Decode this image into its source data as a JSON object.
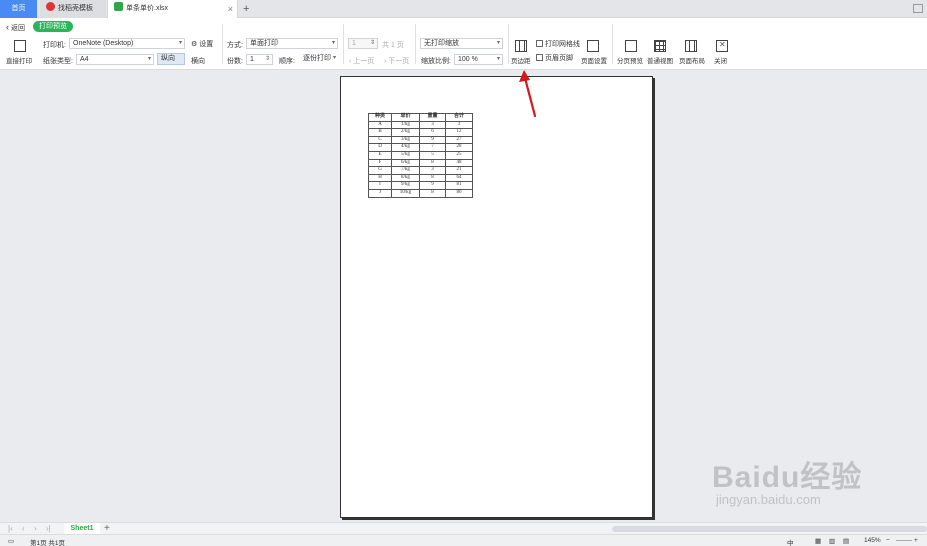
{
  "tabs": {
    "home": "首页",
    "second": "找稻壳模板",
    "active": "单条单价.xlsx",
    "close_glyph": "×",
    "add_glyph": "+"
  },
  "toolbar": {
    "back_label": "返回",
    "badge": "打印预览",
    "direct_print": "直接打印",
    "printer_label": "打印机:",
    "printer_value": "OneNote (Desktop)",
    "settings": "设置",
    "paper_label": "纸张类型:",
    "paper_value": "A4",
    "portrait": "纵向",
    "landscape": "横向",
    "mode_label": "方式:",
    "mode_value": "单面打印",
    "copies_label": "份数:",
    "copies_value": "1",
    "order_label": "顺序:",
    "order_value": "逐份打印",
    "page_input": "1",
    "page_total": "共 1 页",
    "prev_page": "上一页",
    "next_page": "下一页",
    "scale_value": "无打印缩放",
    "zoom_label": "缩放比例:",
    "zoom_value": "100 %",
    "margins": "页边距",
    "print_gridlines": "打印网格线",
    "header_footer": "页眉页脚",
    "page_setup": "页面设置",
    "page_break": "分页预览",
    "normal_view": "普通视图",
    "page_layout": "页面布局",
    "close": "关闭"
  },
  "table": {
    "headers": [
      "种类",
      "单价",
      "重量",
      "合计"
    ],
    "rows": [
      [
        "A",
        "1/kg",
        "3",
        "3"
      ],
      [
        "B",
        "2/kg",
        "6",
        "12"
      ],
      [
        "C",
        "3/kg",
        "9",
        "27"
      ],
      [
        "D",
        "4/kg",
        "7",
        "28"
      ],
      [
        "E",
        "5/kg",
        "5",
        "25"
      ],
      [
        "F",
        "6/kg",
        "8",
        "48"
      ],
      [
        "G",
        "7/kg",
        "3",
        "21"
      ],
      [
        "H",
        "8/kg",
        "8",
        "64"
      ],
      [
        "I",
        "9/kg",
        "9",
        "81"
      ],
      [
        "J",
        "10/kg",
        "8",
        "80"
      ]
    ]
  },
  "sheet": {
    "tab": "Sheet1",
    "add": "+"
  },
  "status": {
    "page_info": "第1页 共1页",
    "zoom": "145%",
    "input_mode": "中"
  },
  "watermark": {
    "brand": "Baidu经验",
    "url": "jingyan.baidu.com"
  },
  "colors": {
    "accent_green": "#2cb45a",
    "home_tab": "#4a8af4",
    "arrow_red": "#d0191b"
  }
}
